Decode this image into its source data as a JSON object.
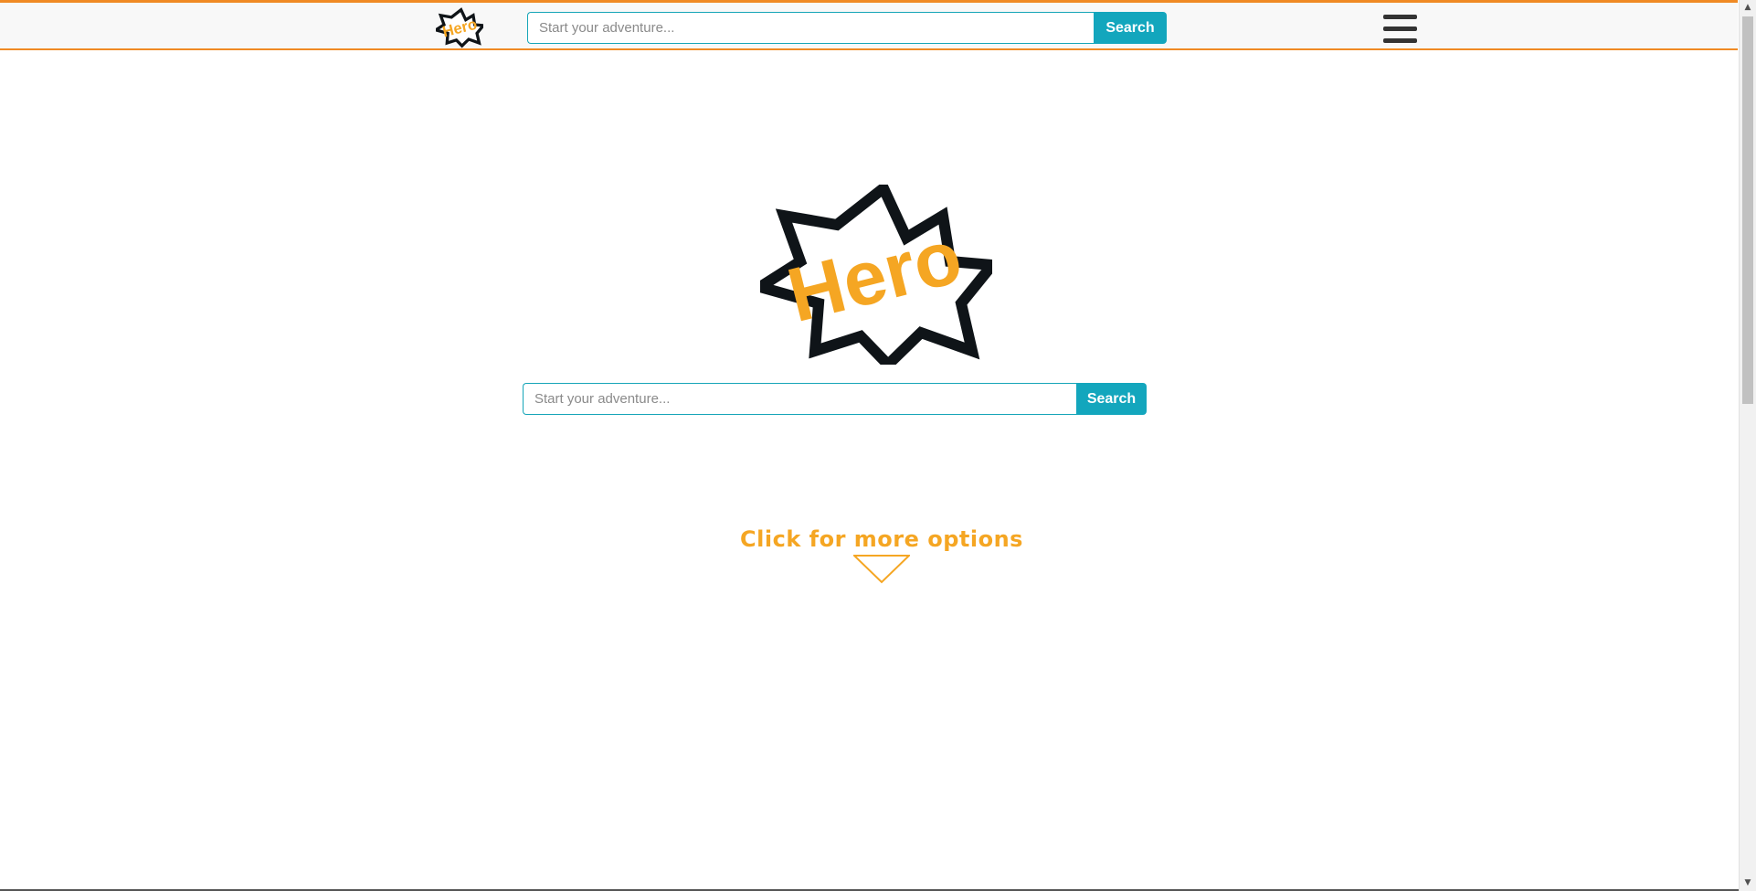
{
  "header": {
    "logo_text": "Hero",
    "search_placeholder": "Start your adventure...",
    "search_button": "Search",
    "menu_icon": "hamburger-menu-icon"
  },
  "hero": {
    "logo_text": "Hero",
    "search_placeholder": "Start your adventure...",
    "search_button": "Search",
    "more_options_label": "Click for more options",
    "more_options_icon": "triangle-down-icon"
  },
  "colors": {
    "accent_orange": "#f08a24",
    "logo_yellow": "#f5a623",
    "search_teal": "#13a6bd",
    "text_dark": "#333333"
  },
  "scrollbar": {
    "up_icon": "▲",
    "down_icon": "▼"
  }
}
